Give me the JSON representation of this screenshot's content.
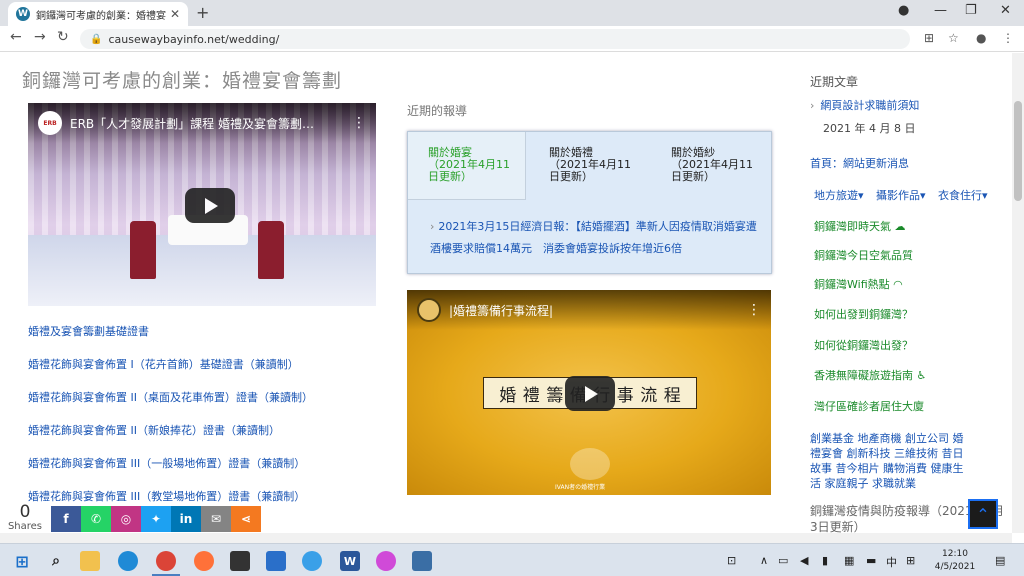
{
  "browser": {
    "tab_title": "銅鑼灣可考慮的創業：婚禮宴會籌…",
    "tab_favicon": "W",
    "url": "causewaybayinfo.net/wedding/"
  },
  "page": {
    "title": "銅鑼灣可考慮的創業：婚禮宴會籌劃",
    "video1_title": "ERB「人才發展計劃」課程 婚禮及宴會籌劃…",
    "video1_channel": "ERB",
    "links": [
      "婚禮及宴會籌劃基礎證書",
      "婚禮花飾與宴會佈置 I（花卉首飾）基礎證書（兼讀制）",
      "婚禮花飾與宴會佈置 II（桌面及花車佈置）證書（兼讀制）",
      "婚禮花飾與宴會佈置 II（新娘捧花）證書（兼讀制）",
      "婚禮花飾與宴會佈置 III（一般場地佈置）證書（兼讀制）",
      "婚禮花飾與宴會佈置 III（教堂場地佈置）證書（兼讀制）"
    ],
    "news_heading": "近期的報導",
    "news_tabs": [
      {
        "title": "關於婚宴",
        "sub": "（2021年4月11日更新）"
      },
      {
        "title": "關於婚禮",
        "sub": "（2021年4月11日更新）"
      },
      {
        "title": "關於婚紗",
        "sub": "（2021年4月11日更新）"
      }
    ],
    "news_item": "2021年3月15日經濟日報：【結婚擺酒】準新人因疫情取消婚宴遭酒樓要求賠償14萬元　消委會婚宴投訴按年增近6倍",
    "video2_title": "|婚禮籌備行事流程|",
    "video2_banner": [
      "婚",
      "禮",
      "籌",
      "備",
      "行",
      "事",
      "流",
      "程"
    ],
    "video2_caption": "IVAN者の婚禮行業"
  },
  "sidebar": {
    "recent_heading": "近期文章",
    "recent_post": "網頁設計求職前須知",
    "recent_date": "2021 年 4 月 8 日",
    "home_link": "首頁：網站更新消息",
    "menu": [
      "地方旅遊▾",
      "攝影作品▾",
      "衣食住行▾"
    ],
    "green_links": [
      "銅鑼灣即時天氣",
      "銅鑼灣今日空氣品質",
      "銅鑼灣Wifi熱點",
      "如何出發到銅鑼灣？",
      "如何從銅鑼灣出發？",
      "香港無障礙旅遊指南",
      "灣仔區確診者居住大廈"
    ],
    "tags": "創業基金 地產商機 創立公司 婚禮宴會 創新科技 三維技術 昔日故事 昔今相片 購物消費 健康生活 家庭親子 求職就業",
    "epidemic": "銅鑼灣疫情與防疫報導（2021年5月3日更新）"
  },
  "share": {
    "count": "0",
    "label": "Shares",
    "buttons": [
      {
        "icon": "f",
        "color": "#3b5998",
        "name": "facebook"
      },
      {
        "icon": "✆",
        "color": "#25d366",
        "name": "whatsapp"
      },
      {
        "icon": "◎",
        "color": "#c13584",
        "name": "instagram"
      },
      {
        "icon": "✦",
        "color": "#1da1f2",
        "name": "twitter"
      },
      {
        "icon": "in",
        "color": "#0077b5",
        "name": "linkedin"
      },
      {
        "icon": "✉",
        "color": "#848484",
        "name": "email"
      },
      {
        "icon": "⋖",
        "color": "#f47920",
        "name": "more"
      }
    ]
  },
  "taskbar": {
    "time": "12:10",
    "date": "4/5/2021",
    "ime": "中"
  }
}
